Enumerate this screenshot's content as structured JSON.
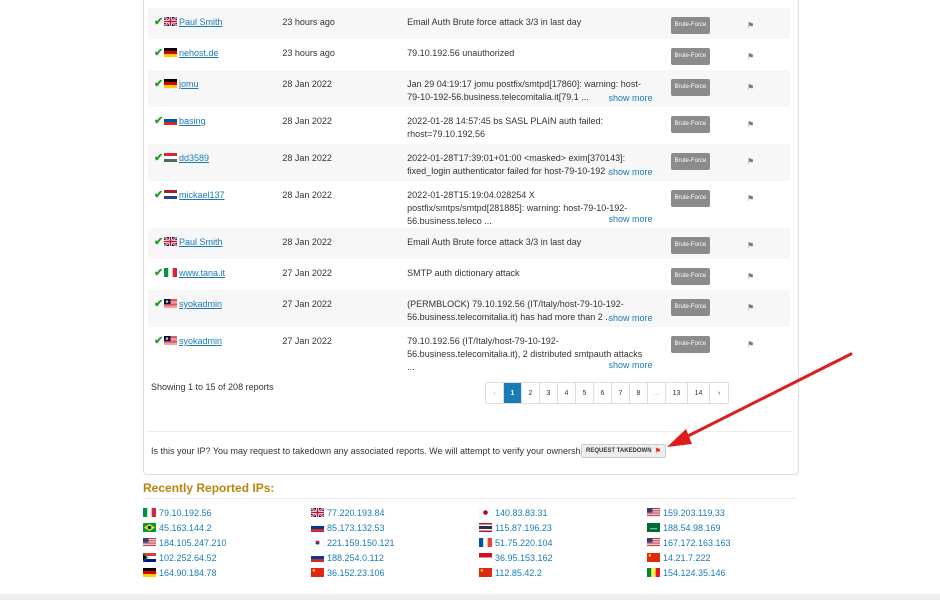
{
  "reports": [
    {
      "user": "Paul Smith",
      "flag": "gb",
      "date": "23 hours ago",
      "comment": "Email Auth Brute force attack 3/3 in last day",
      "more": "",
      "category": "Brute-Force",
      "tall": false
    },
    {
      "user": "nehost.de",
      "flag": "de",
      "date": "23 hours ago",
      "comment": "79.10.192.56 unauthorized",
      "more": "",
      "category": "Brute-Force",
      "tall": false
    },
    {
      "user": "jomu",
      "flag": "de",
      "date": "28 Jan 2022",
      "comment": "Jan 29 04:19:17 jomu postfix/smtpd[17860]: warning: host-79-10-192-56.business.telecomitalia.it[79.1 ...",
      "more": "show more",
      "category": "Brute-Force",
      "tall": true
    },
    {
      "user": "basing",
      "flag": "si",
      "date": "28 Jan 2022",
      "comment": "2022-01-28 14:57:45 bs SASL PLAIN auth failed: rhost=79.10.192.56",
      "more": "",
      "category": "Brute-Force",
      "tall": true
    },
    {
      "user": "dd3589",
      "flag": "hu",
      "date": "28 Jan 2022",
      "comment": "2022-01-28T17:39:01+01:00 <masked> exim[370143]: fixed_login authenticator failed for host-79-10-192 ...",
      "more": "show more",
      "category": "Brute-Force",
      "tall": true
    },
    {
      "user": "mickael137",
      "flag": "nl",
      "date": "28 Jan 2022",
      "comment": "2022-01-28T15:19:04.028254 X postfix/smtps/smtpd[281885]: warning: host-79-10-192-56.business.teleco ...",
      "more": "show more",
      "category": "Brute-Force",
      "tall": true
    },
    {
      "user": "Paul Smith",
      "flag": "gb",
      "date": "28 Jan 2022",
      "comment": "Email Auth Brute force attack 3/3 in last day",
      "more": "",
      "category": "Brute-Force",
      "tall": false
    },
    {
      "user": "www.tana.it",
      "flag": "it",
      "date": "27 Jan 2022",
      "comment": "SMTP auth dictionary attack",
      "more": "",
      "category": "Brute-Force",
      "tall": false
    },
    {
      "user": "syokadmin",
      "flag": "my",
      "date": "27 Jan 2022",
      "comment": "(PERMBLOCK) 79.10.192.56 (IT/Italy/host-79-10-192-56.business.telecomitalia.it) has had more than 2 ...",
      "more": "show more",
      "category": "Brute-Force",
      "tall": true
    },
    {
      "user": "syokadmin",
      "flag": "my",
      "date": "27 Jan 2022",
      "comment": "79.10.192.56 (IT/Italy/host-79-10-192-56.business.telecomitalia.it), 2 distributed smtpauth attacks ...",
      "more": "show more",
      "category": "Brute-Force",
      "tall": true
    }
  ],
  "pagination": {
    "summary": "Showing 1 to 15 of 208 reports",
    "pages": [
      "‹",
      "1",
      "2",
      "3",
      "4",
      "5",
      "6",
      "7",
      "8",
      "...",
      "13",
      "14",
      "›"
    ],
    "active": "1"
  },
  "takedown": {
    "text": "Is this your IP? You may request to takedown any associated reports. We will attempt to verify your ownership.",
    "button": "REQUEST TAKEDOWN"
  },
  "recent": {
    "title": "Recently Reported IPs:",
    "ips": [
      {
        "ip": "79.10.192.56",
        "flag": "it"
      },
      {
        "ip": "77.220.193.84",
        "flag": "gb"
      },
      {
        "ip": "140.83.83.31",
        "flag": "jp"
      },
      {
        "ip": "159.203.119.33",
        "flag": "us"
      },
      {
        "ip": "45.163.144.2",
        "flag": "br"
      },
      {
        "ip": "85.173.132.53",
        "flag": "ru"
      },
      {
        "ip": "115.87.196.23",
        "flag": "th"
      },
      {
        "ip": "188.54.98.169",
        "flag": "sa"
      },
      {
        "ip": "184.105.247.210",
        "flag": "us"
      },
      {
        "ip": "221.159.150.121",
        "flag": "kr"
      },
      {
        "ip": "51.75.220.104",
        "flag": "fr"
      },
      {
        "ip": "167.172.163.163",
        "flag": "us"
      },
      {
        "ip": "102.252.64.52",
        "flag": "za"
      },
      {
        "ip": "188.254.0.112",
        "flag": "ru"
      },
      {
        "ip": "36.95.153.162",
        "flag": "id"
      },
      {
        "ip": "14.21.7.222",
        "flag": "cn"
      },
      {
        "ip": "164.90.184.78",
        "flag": "de"
      },
      {
        "ip": "36.152.23.106",
        "flag": "cn"
      },
      {
        "ip": "112.85.42.2",
        "flag": "cn"
      },
      {
        "ip": "154.124.35.146",
        "flag": "sn"
      }
    ]
  },
  "colors": {
    "link": "#1a7bb9",
    "accent": "#b8860b",
    "badge": "#8b8b8b",
    "check": "#2b9a2b",
    "arrow": "#e01b1b"
  }
}
